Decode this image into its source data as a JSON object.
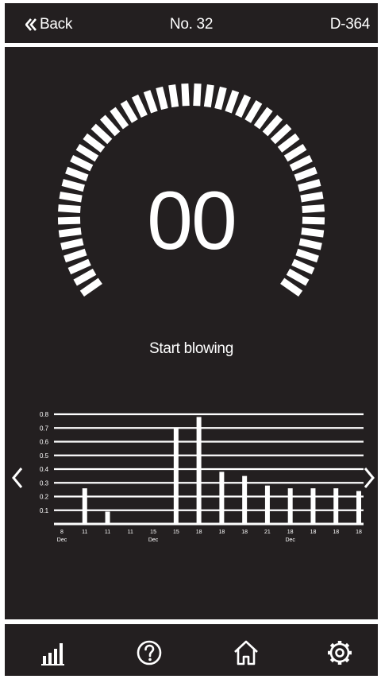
{
  "header": {
    "back_label": "Back",
    "title": "No. 32",
    "device_id": "D-364"
  },
  "gauge": {
    "value": "00",
    "level": 0,
    "status": "Start blowing"
  },
  "chart_data": {
    "type": "bar",
    "title": "",
    "xlabel": "",
    "ylabel": "",
    "ylim": [
      0,
      0.8
    ],
    "y_ticks": [
      "0.1",
      "0.2",
      "0.3",
      "0.4",
      "0.5",
      "0.6",
      "0.7",
      "0.8"
    ],
    "categories": [
      "8",
      "11",
      "11",
      "11",
      "15",
      "15",
      "18",
      "18",
      "18",
      "21",
      "18",
      "18",
      "18",
      "18"
    ],
    "values": [
      0.0,
      0.26,
      0.09,
      0.0,
      0.0,
      0.7,
      0.78,
      0.38,
      0.35,
      0.28,
      0.26,
      0.26,
      0.26,
      0.24
    ],
    "month_labels": [
      {
        "index": 0,
        "text": "Dec"
      },
      {
        "index": 4,
        "text": "Dec"
      },
      {
        "index": 10,
        "text": "Dec"
      }
    ],
    "grid": true,
    "legend": "none"
  },
  "nav": {
    "prev_icon": "chevron-left-icon",
    "next_icon": "chevron-right-icon"
  },
  "footer": {
    "items": [
      {
        "icon": "bar-chart-icon"
      },
      {
        "icon": "help-icon"
      },
      {
        "icon": "home-icon"
      },
      {
        "icon": "settings-icon"
      }
    ]
  },
  "colors": {
    "background": "#231f20",
    "foreground": "#ffffff"
  }
}
